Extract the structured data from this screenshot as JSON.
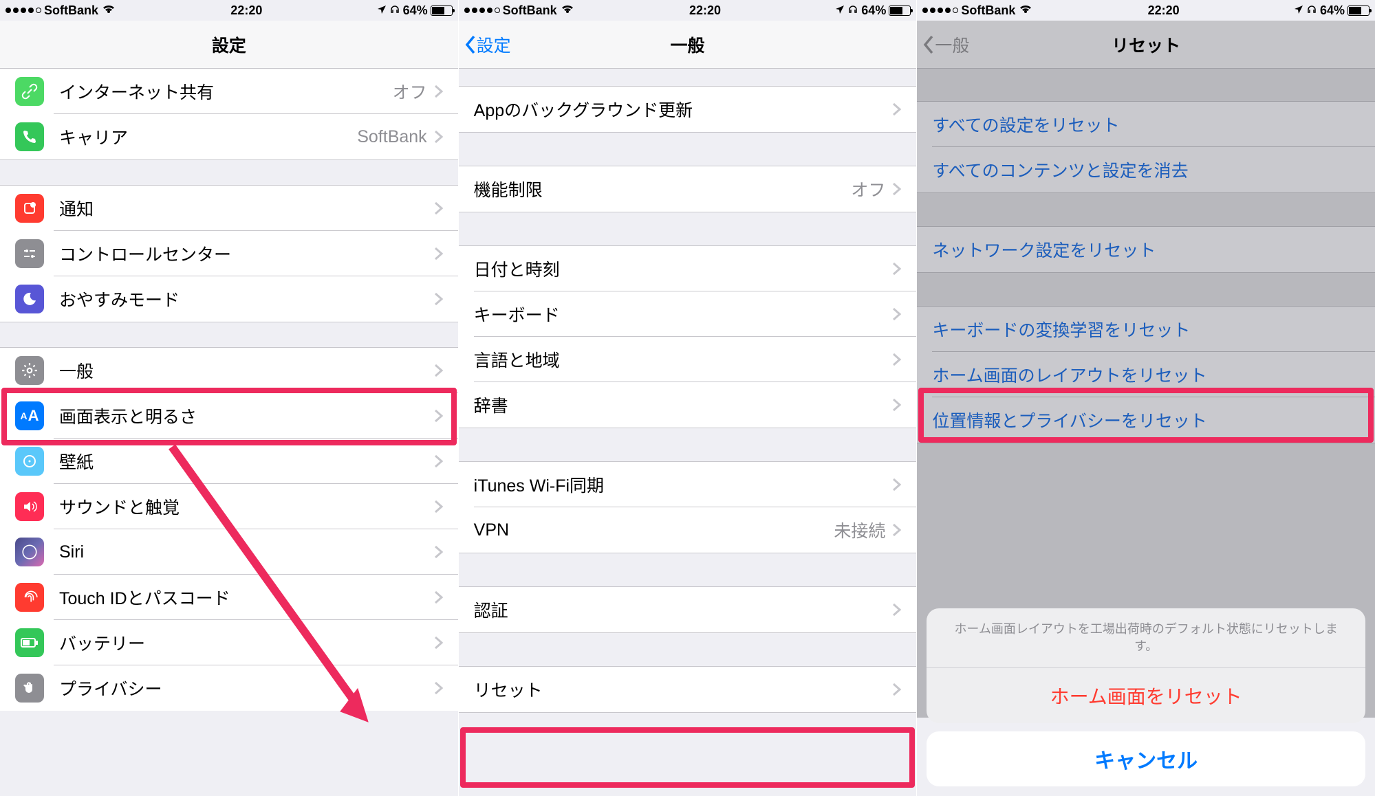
{
  "status": {
    "carrier": "SoftBank",
    "time": "22:20",
    "battery": "64%"
  },
  "s1": {
    "title": "設定",
    "r_internet": "インターネット共有",
    "v_internet": "オフ",
    "r_carrier": "キャリア",
    "v_carrier": "SoftBank",
    "r_notif": "通知",
    "r_control": "コントロールセンター",
    "r_dnd": "おやすみモード",
    "r_general": "一般",
    "r_display": "画面表示と明るさ",
    "r_wallpaper": "壁紙",
    "r_sound": "サウンドと触覚",
    "r_siri": "Siri",
    "r_touchid": "Touch IDとパスコード",
    "r_battery": "バッテリー",
    "r_privacy": "プライバシー"
  },
  "s2": {
    "back": "設定",
    "title": "一般",
    "r_bgapp": "Appのバックグラウンド更新",
    "r_restrict": "機能制限",
    "v_restrict": "オフ",
    "r_date": "日付と時刻",
    "r_keyboard": "キーボード",
    "r_lang": "言語と地域",
    "r_dict": "辞書",
    "r_itunes": "iTunes Wi-Fi同期",
    "r_vpn": "VPN",
    "v_vpn": "未接続",
    "r_cert": "認証",
    "r_reset": "リセット"
  },
  "s3": {
    "back": "一般",
    "title": "リセット",
    "r_all": "すべての設定をリセット",
    "r_erase": "すべてのコンテンツと設定を消去",
    "r_net": "ネットワーク設定をリセット",
    "r_kbd": "キーボードの変換学習をリセット",
    "r_home": "ホーム画面のレイアウトをリセット",
    "r_loc": "位置情報とプライバシーをリセット",
    "sheet_msg": "ホーム画面レイアウトを工場出荷時のデフォルト状態にリセットします。",
    "sheet_action": "ホーム画面をリセット",
    "sheet_cancel": "キャンセル"
  }
}
